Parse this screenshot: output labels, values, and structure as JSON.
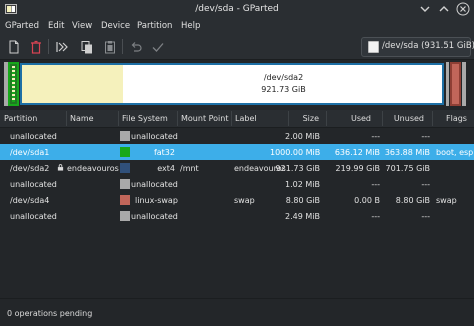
{
  "window": {
    "title": "/dev/sda - GParted"
  },
  "menubar": {
    "items": [
      "GParted",
      "Edit",
      "View",
      "Device",
      "Partition",
      "Help"
    ]
  },
  "device_selector": {
    "label": "/dev/sda (931.51 GiB)"
  },
  "diskmap": {
    "selected_partition": {
      "name": "/dev/sda2",
      "size": "921.73 GiB"
    }
  },
  "table": {
    "columns": [
      "Partition",
      "Name",
      "File System",
      "Mount Point",
      "Label",
      "Size",
      "Used",
      "Unused",
      "Flags"
    ],
    "rows": [
      {
        "partition": "unallocated",
        "name": "",
        "fs": "unallocated",
        "fs_color": "#a9a9a9",
        "mount": "",
        "label": "",
        "size": "2.00 MiB",
        "used": "---",
        "unused": "---",
        "flags": ""
      },
      {
        "partition": "/dev/sda1",
        "name": "",
        "fs": "fat32",
        "fs_color": "#18a81b",
        "mount": "",
        "label": "",
        "size": "1000.00 MiB",
        "used": "636.12 MiB",
        "unused": "363.88 MiB",
        "flags": "boot, esp",
        "selected": true
      },
      {
        "partition": "/dev/sda2",
        "name": "endeavouros",
        "fs": "ext4",
        "fs_color": "#30507a",
        "mount": "/mnt",
        "label": "endeavouros",
        "size": "921.73 GiB",
        "used": "219.99 GiB",
        "unused": "701.75 GiB",
        "flags": "",
        "locked": true
      },
      {
        "partition": "unallocated",
        "name": "",
        "fs": "unallocated",
        "fs_color": "#a9a9a9",
        "mount": "",
        "label": "",
        "size": "1.02 MiB",
        "used": "---",
        "unused": "---",
        "flags": ""
      },
      {
        "partition": "/dev/sda4",
        "name": "",
        "fs": "linux-swap",
        "fs_color": "#c1665a",
        "mount": "",
        "label": "swap",
        "size": "8.80 GiB",
        "used": "0.00 B",
        "unused": "8.80 GiB",
        "flags": "swap"
      },
      {
        "partition": "unallocated",
        "name": "",
        "fs": "unallocated",
        "fs_color": "#a9a9a9",
        "mount": "",
        "label": "",
        "size": "2.49 MiB",
        "used": "---",
        "unused": "---",
        "flags": ""
      }
    ]
  },
  "statusbar": {
    "text": "0 operations pending"
  },
  "icons": {
    "app": "gparted-app-icon",
    "minimize": "chevron-down-icon",
    "maximize": "chevron-up-icon",
    "close": "close-icon",
    "new": "new-document-icon",
    "delete": "delete-icon",
    "resize": "resize-move-icon",
    "copy": "copy-icon",
    "paste": "paste-icon",
    "undo": "undo-icon",
    "apply": "apply-checkmark-icon"
  }
}
